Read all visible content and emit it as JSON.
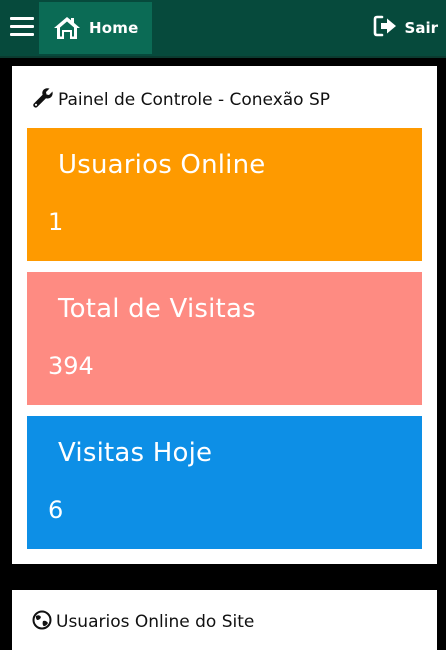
{
  "topbar": {
    "menu_icon": "hamburger-icon",
    "home_icon": "home-icon",
    "home_label": "Home",
    "logout_icon": "sign-out-icon",
    "logout_label": "Sair",
    "background": "#064a3c",
    "active_tab_color": "#0b6b55"
  },
  "panel": {
    "header_icon": "wrench-icon",
    "title": "Painel de Controle - Conexão SP",
    "cards": [
      {
        "title": "Usuarios Online",
        "value": "1",
        "color": "#fe9a00"
      },
      {
        "title": "Total de Visitas",
        "value": "394",
        "color": "#fe8b82"
      },
      {
        "title": "Visitas Hoje",
        "value": "6",
        "color": "#0d8fe6"
      }
    ]
  },
  "panel2": {
    "header_icon": "globe-icon",
    "title": "Usuarios Online do Site"
  }
}
